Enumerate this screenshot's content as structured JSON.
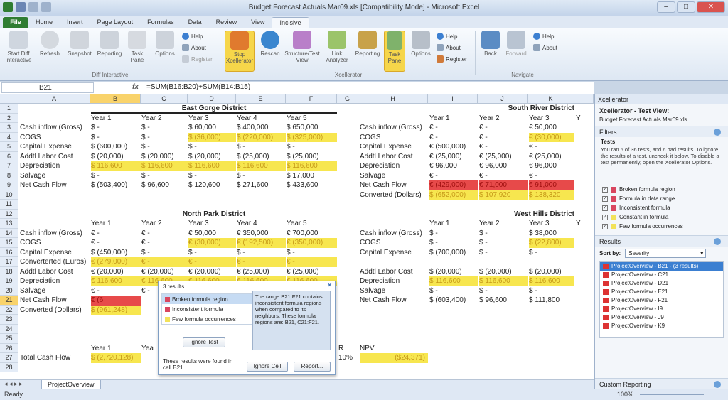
{
  "window": {
    "title": "Budget Forecast Actuals Mar09.xls  [Compatibility Mode]  -  Microsoft Excel"
  },
  "tabs": [
    "File",
    "Home",
    "Insert",
    "Page Layout",
    "Formulas",
    "Data",
    "Review",
    "View",
    "Incisive"
  ],
  "ribbon": {
    "diff": [
      "Start Diff Interactive",
      "Refresh",
      "Snapshot",
      "Reporting",
      "Task Pane",
      "Options"
    ],
    "diff_small": [
      "Help",
      "About",
      "Register"
    ],
    "diff_group": "Diff Interactive",
    "xc": [
      "Stop Xcellerator",
      "Rescan",
      "Structure/Test View",
      "Link Analyzer",
      "Reporting",
      "Task Pane",
      "Options"
    ],
    "xc_small": [
      "Help",
      "About",
      "Register"
    ],
    "xc_group": "Xcellerator",
    "nav": [
      "Back",
      "Forward"
    ],
    "nav_small": [
      "Help",
      "About"
    ],
    "nav_group": "Navigate"
  },
  "formula_bar": {
    "name": "B21",
    "fx": "fx",
    "formula": "=SUM(B16:B20)+SUM(B14:B15)"
  },
  "columns": [
    "A",
    "B",
    "C",
    "D",
    "E",
    "F",
    "G",
    "H",
    "I",
    "J",
    "K"
  ],
  "rows": [
    "1",
    "2",
    "3",
    "4",
    "5",
    "6",
    "7",
    "8",
    "9",
    "10",
    "11",
    "12",
    "13",
    "14",
    "15",
    "16",
    "17",
    "18",
    "19",
    "20",
    "21",
    "22",
    "23",
    "24",
    "25",
    "26",
    "27",
    "28"
  ],
  "sheet": {
    "east_title": "East Gorge District",
    "south_title": "South River District",
    "north_title": "North Park District",
    "west_title": "West Hills District",
    "years": [
      "Year 1",
      "Year 2",
      "Year 3",
      "Year 4",
      "Year 5"
    ],
    "east": [
      {
        "label": "Cash inflow (Gross)",
        "cells": [
          "$  -",
          "$  -",
          "$  60,000",
          "$  400,000",
          "$  650,000"
        ]
      },
      {
        "label": "COGS",
        "cells": [
          "$  -",
          "$  -",
          "$  (36,000)",
          "$  (220,000)",
          "$  (325,000)"
        ]
      },
      {
        "label": "Capital Expense",
        "cells": [
          "$  (600,000)",
          "$  -",
          "$  -",
          "$  -",
          "$  -"
        ]
      },
      {
        "label": "Addtl Labor Cost",
        "cells": [
          "$  (20,000)",
          "$  (20,000)",
          "$  (20,000)",
          "$  (25,000)",
          "$  (25,000)"
        ]
      },
      {
        "label": "Depreciation",
        "cells": [
          "$  116,600",
          "$  116,600",
          "$  116,600",
          "$  116,600",
          "$  116,600"
        ]
      },
      {
        "label": "Salvage",
        "cells": [
          "$  -",
          "$  -",
          "$  -",
          "$  -",
          "$  17,000"
        ]
      },
      {
        "label": "Net Cash Flow",
        "cells": [
          "$  (503,400)",
          "$  96,600",
          "$  120,600",
          "$  271,600",
          "$  433,600"
        ]
      }
    ],
    "south": [
      {
        "label": "Cash inflow (Gross)",
        "cells": [
          "€  -",
          "€  -",
          "€  50,000"
        ]
      },
      {
        "label": "COGS",
        "cells": [
          "€  -",
          "€  -",
          "€  (30,000)"
        ]
      },
      {
        "label": "Capital Expense",
        "cells": [
          "€  (500,000)",
          "€  -",
          "€  -"
        ]
      },
      {
        "label": "Addtl Labor Cost",
        "cells": [
          "€  (25,000)",
          "€  (25,000)",
          "€  (25,000)"
        ]
      },
      {
        "label": "Depreciation",
        "cells": [
          "€  96,000",
          "€  96,000",
          "€  96,000"
        ]
      },
      {
        "label": "Salvage",
        "cells": [
          "€  -",
          "€  -",
          "€  -"
        ]
      },
      {
        "label": "Net Cash Flow",
        "cells": [
          "€  (429,000)",
          "€  71,000",
          "€  91,000"
        ]
      },
      {
        "label": "Converted (Dollars)",
        "cells": [
          "$  (652,000)",
          "$  107,920",
          "$  138,320"
        ]
      }
    ],
    "north": [
      {
        "label": "Cash inflow (Gross)",
        "cells": [
          "€  -",
          "€  -",
          "€  50,000",
          "€  350,000",
          "€  700,000"
        ]
      },
      {
        "label": "COGS",
        "cells": [
          "€  -",
          "€  -",
          "€  (30,000)",
          "€  (192,500)",
          "€  (350,000)"
        ]
      },
      {
        "label": "Capital Expense",
        "cells": [
          "$  (450,000)",
          "$  -",
          "$  -",
          "$  -",
          "$  -"
        ]
      },
      {
        "label": "Converterted (Euros)",
        "cells": [
          "€  (279,000)",
          "€  -",
          "€  -",
          "€  -",
          "€  -"
        ]
      },
      {
        "label": "Addtl Labor Cost",
        "cells": [
          "€  (20,000)",
          "€  (20,000)",
          "€  (20,000)",
          "€  (25,000)",
          "€  (25,000)"
        ]
      },
      {
        "label": "Depreciation",
        "cells": [
          "€  116,600",
          "€  116,600",
          "€  116,600",
          "€  116,600",
          "€  116,600"
        ]
      },
      {
        "label": "Salvage",
        "cells": [
          "€  -",
          "€  -",
          "€  -",
          "€  -",
          "€  -"
        ]
      },
      {
        "label": "Net Cash Flow",
        "cells": [
          "€  (6",
          "",
          "",
          "",
          ""
        ]
      },
      {
        "label": "Converted (Dollars)",
        "cells": [
          "$  (961,248)",
          "",
          "",
          "",
          ""
        ]
      }
    ],
    "west": [
      {
        "label": "Cash inflow (Gross)",
        "cells": [
          "$  -",
          "$  -",
          "$  38,000"
        ]
      },
      {
        "label": "COGS",
        "cells": [
          "$  -",
          "$  -",
          "$  (22,800)"
        ]
      },
      {
        "label": "Capital Expense",
        "cells": [
          "$  (700,000)",
          "$  -",
          "$  -"
        ]
      },
      {
        "label": "",
        "cells": [
          "",
          "",
          ""
        ]
      },
      {
        "label": "Addtl Labor Cost",
        "cells": [
          "$  (20,000)",
          "$  (20,000)",
          "$  (20,000)"
        ]
      },
      {
        "label": "Depreciation",
        "cells": [
          "$  116,600",
          "$  116,600",
          "$  116,600"
        ]
      },
      {
        "label": "Salvage",
        "cells": [
          "$  -",
          "$  -",
          "$  -"
        ]
      },
      {
        "label": "Net Cash Flow",
        "cells": [
          "$  (603,400)",
          "$  96,600",
          "$  111,800"
        ]
      }
    ],
    "total_years": [
      "Year 1",
      "Yea"
    ],
    "total_label": "Total Cash Flow",
    "total_b": "$  (2,720,128)",
    "g26": "R",
    "g27": "10%",
    "npv_label": "NPV",
    "npv_value": "($24,371)",
    "south_cut": [
      "Y",
      "Y"
    ]
  },
  "popup": {
    "count": "3 results",
    "items": [
      "Broken formula region",
      "Inconsistent formula",
      "Few formula occurrences"
    ],
    "bubble": "The range B21:F21 contains inconsistent formula regions when compared to its neighbors. These formula regions are: B21, C21:F21.",
    "ignore_test": "Ignore Test",
    "found": "These results were found in cell B21.",
    "ignore_cell": "Ignore Cell",
    "report": "Report..."
  },
  "sheet_tab": "ProjectOverview",
  "status": {
    "left": "Ready",
    "zoom": "100%"
  },
  "pane": {
    "header": "Xcellerator",
    "title": "Xcellerator - Test View:",
    "file": "Budget Forecast Actuals Mar09.xls",
    "filters": "Filters",
    "tests": "Tests",
    "tests_desc": "You ran 6 of 36 tests, and 6 had results. To ignore the results of a test, uncheck it below. To disable a test permanently, open the Xcellerator Options.",
    "checks": [
      "Broken formula region",
      "Formula in data range",
      "Inconsistent formula",
      "Constant in formula",
      "Few formula occurrences"
    ],
    "results": "Results",
    "sort_label": "Sort by:",
    "sort_value": "Severity",
    "result_items": [
      "ProjectOverview - B21 - (3 results)",
      "ProjectOverview - C21",
      "ProjectOverview - D21",
      "ProjectOverview - E21",
      "ProjectOverview - F21",
      "ProjectOverview - I9",
      "ProjectOverview - J9",
      "ProjectOverview - K9"
    ],
    "custom": "Custom Reporting"
  }
}
